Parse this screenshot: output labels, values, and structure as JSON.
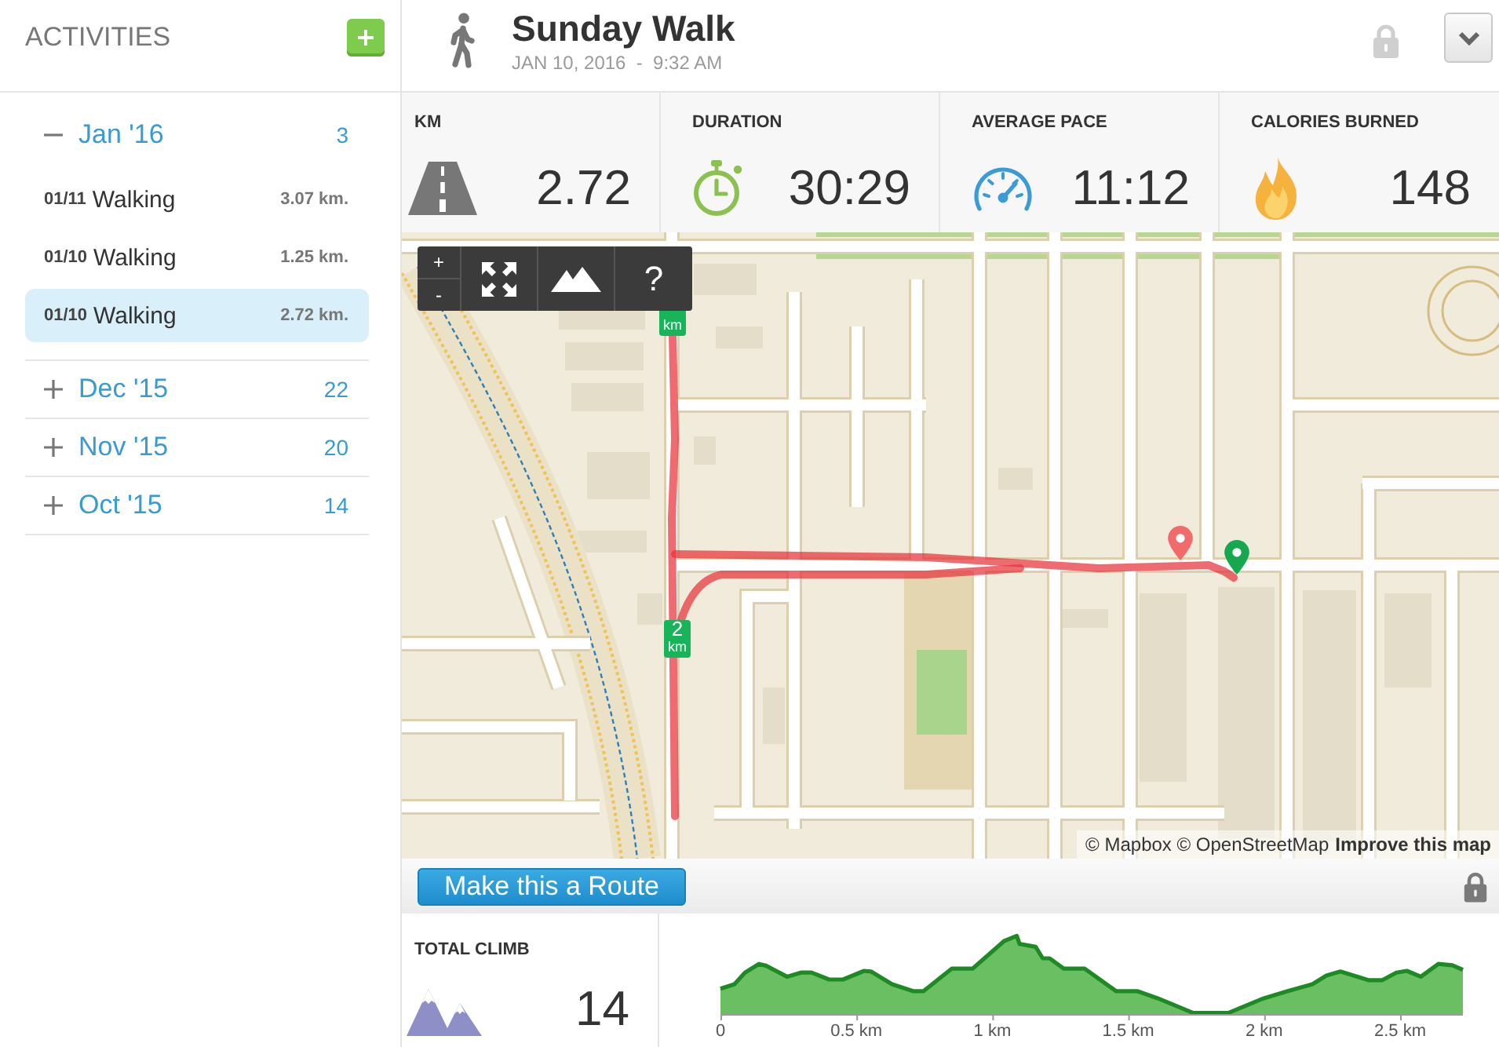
{
  "sidebar": {
    "title": "ACTIVITIES",
    "months": [
      {
        "label": "Jan '16",
        "count": "3",
        "expanded": true,
        "items": [
          {
            "date": "01/11",
            "type": "Walking",
            "distance": "3.07 km.",
            "selected": false
          },
          {
            "date": "01/10",
            "type": "Walking",
            "distance": "1.25 km.",
            "selected": false
          },
          {
            "date": "01/10",
            "type": "Walking",
            "distance": "2.72 km.",
            "selected": true
          }
        ]
      },
      {
        "label": "Dec '15",
        "count": "22",
        "expanded": false
      },
      {
        "label": "Nov '15",
        "count": "20",
        "expanded": false
      },
      {
        "label": "Oct '15",
        "count": "14",
        "expanded": false
      }
    ]
  },
  "activity": {
    "title": "Sunday Walk",
    "datetime": "JAN 10, 2016  -  9:32 AM"
  },
  "stats": [
    {
      "kind": "distance",
      "label": "KM",
      "value": "2.72"
    },
    {
      "kind": "duration",
      "label": "DURATION",
      "value": "30:29"
    },
    {
      "kind": "pace",
      "label": "AVERAGE PACE",
      "value": "11:12"
    },
    {
      "kind": "calories",
      "label": "CALORIES BURNED",
      "value": "148"
    }
  ],
  "map": {
    "controls": {
      "zoom_in": "+",
      "zoom_out": "-",
      "help": "?"
    },
    "km_markers": [
      {
        "unit": "km"
      },
      {
        "value": "2",
        "unit": "km"
      }
    ],
    "pins": [
      {
        "kind": "end",
        "color": "#f26b6b"
      },
      {
        "kind": "start",
        "color": "#17a84f"
      }
    ],
    "attribution": {
      "text": "© Mapbox © OpenStreetMap",
      "link": "Improve this map"
    }
  },
  "route_bar": {
    "button": "Make this a Route"
  },
  "climb": {
    "label": "TOTAL CLIMB",
    "value": "14"
  },
  "elevation": {
    "x_labels": [
      "0",
      "0.5 km",
      "1 km",
      "1.5 km",
      "2 km",
      "2.5 km"
    ]
  }
}
